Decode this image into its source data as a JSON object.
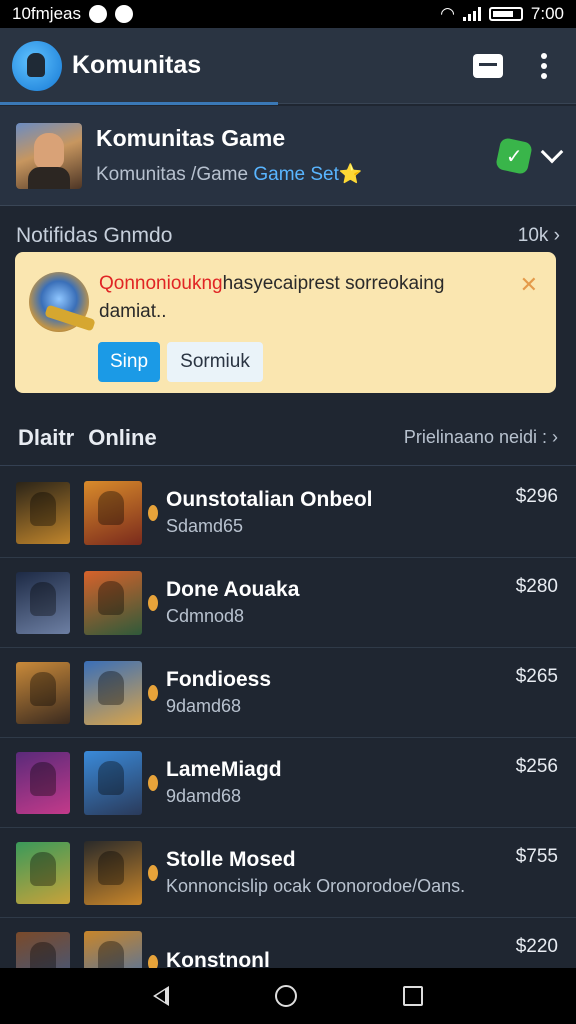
{
  "status_bar": {
    "left_text": "10fmjeas",
    "time": "7:00"
  },
  "app_bar": {
    "title": "Komunitas"
  },
  "community": {
    "name": "Komunitas Game",
    "subtitle_prefix": "Komunitas /Game ",
    "subtitle_link": "Game Set",
    "subtitle_star": "⭐"
  },
  "notifications": {
    "header": "Notifidas Gnmdo",
    "count": "10k",
    "card": {
      "highlight": "Qonnonioukng",
      "text": "hasyecaiprest sorreokaing damiat..",
      "close": "✕",
      "primary_label": "Sinp",
      "secondary_label": "Sormiuk"
    }
  },
  "online": {
    "title_a": "Dlaitr",
    "title_b": "Online",
    "link": "Prielinaano neidi :"
  },
  "games": [
    {
      "name": "Ounstotalian Onbeol",
      "sub": "Sdamd65",
      "price": "$296",
      "thumb1": [
        "#2b2418",
        "#c0852c"
      ],
      "thumb2": [
        "#d98b2b",
        "#7a2a1c"
      ]
    },
    {
      "name": "Done Aouaka",
      "sub": "Cdmnod8",
      "price": "$280",
      "thumb1": [
        "#1d2a45",
        "#6d7fa3"
      ],
      "thumb2": [
        "#d7622b",
        "#2f5a3a"
      ]
    },
    {
      "name": "Fondioess",
      "sub": "9damd68",
      "price": "$265",
      "thumb1": [
        "#c98a3a",
        "#3a2a1f"
      ],
      "thumb2": [
        "#3a6fb8",
        "#d9a44a"
      ]
    },
    {
      "name": "LameMiagd",
      "sub": "9damd68",
      "price": "$256",
      "thumb1": [
        "#5a2a7a",
        "#c33a8a"
      ],
      "thumb2": [
        "#3a8ad9",
        "#2a3a5a"
      ]
    },
    {
      "name": "Stolle Mosed",
      "sub": "Konnoncislip ocak Oronorodoe/Oans.",
      "price": "$755",
      "thumb1": [
        "#3a9a5a",
        "#c8a23a"
      ],
      "thumb2": [
        "#2a2a2a",
        "#c9862a"
      ]
    },
    {
      "name": "Konstnonl",
      "sub": "",
      "price": "$220",
      "thumb1": [
        "#7a4a2a",
        "#3a5a8a"
      ],
      "thumb2": [
        "#c9862a",
        "#3a6fb8"
      ]
    }
  ]
}
